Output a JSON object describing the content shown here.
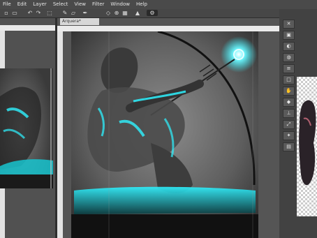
{
  "menu": {
    "items": [
      "File",
      "Edit",
      "Layer",
      "Select",
      "View",
      "Filter",
      "Window",
      "Help"
    ]
  },
  "document": {
    "tab_label": "Arquera*"
  },
  "right_toolbar": {
    "icons": [
      "ink-icon",
      "fill-icon",
      "erase-icon",
      "blend-icon",
      "text-icon",
      "frame-icon",
      "hand-icon",
      "shape-icon",
      "ruler-icon",
      "transform-icon",
      "eyedrop-icon",
      "layer-icon"
    ]
  },
  "colors": {
    "glow": "#2ef2ff",
    "ui_dark": "#3d3d3d",
    "ruler": "#e9e9e9"
  }
}
